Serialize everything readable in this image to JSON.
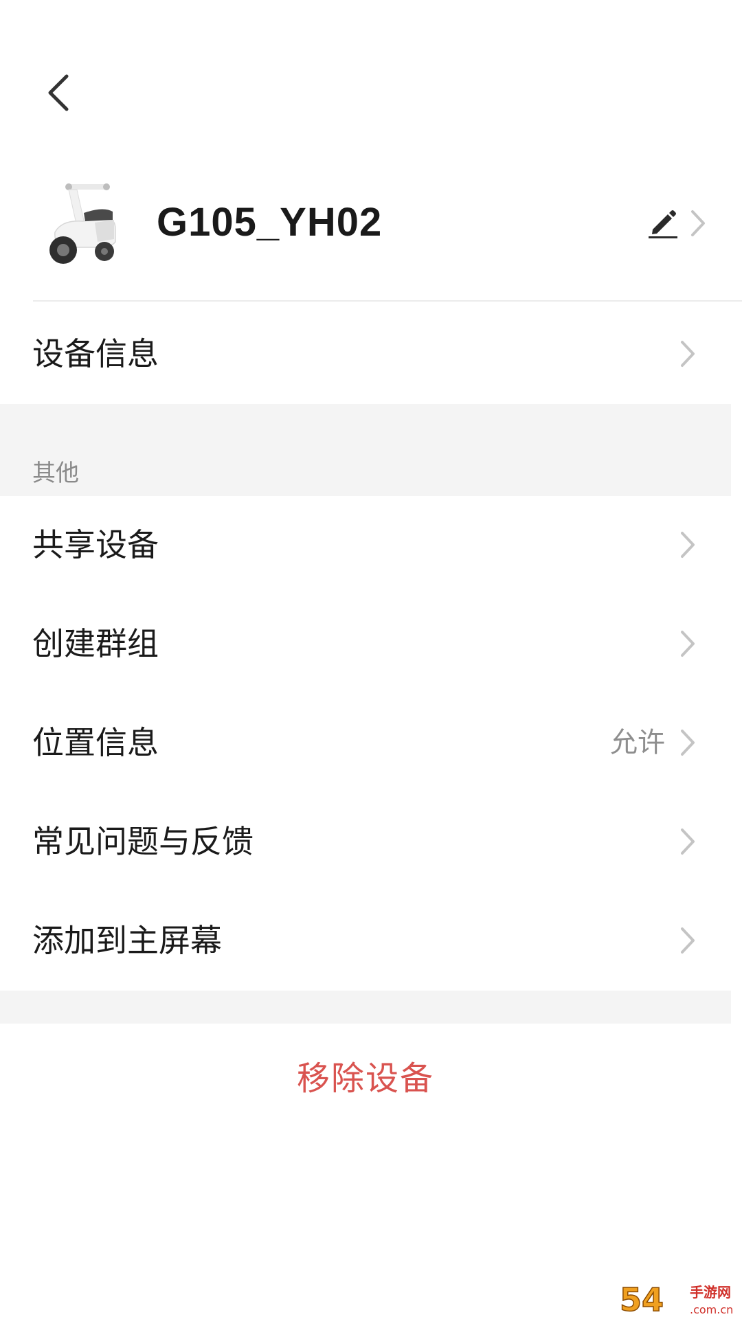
{
  "header": {
    "back_icon": "chevron-left-icon",
    "device_name": "G105_YH02",
    "device_image": "scooter-image",
    "edit_icon": "pencil-icon"
  },
  "device_info_row": {
    "label": "设备信息"
  },
  "section_other": {
    "title": "其他",
    "items": [
      {
        "label": "共享设备",
        "value": ""
      },
      {
        "label": "创建群组",
        "value": ""
      },
      {
        "label": "位置信息",
        "value": "允许"
      },
      {
        "label": "常见问题与反馈",
        "value": ""
      },
      {
        "label": "添加到主屏幕",
        "value": ""
      }
    ]
  },
  "remove_button": {
    "label": "移除设备"
  },
  "watermark": {
    "text_main": "54",
    "text_side": "手游网",
    "text_domain": ".com.cn"
  },
  "colors": {
    "danger": "#d9534f",
    "background": "#ffffff",
    "band": "#f4f4f4",
    "secondary_text": "#8e8e8e"
  }
}
